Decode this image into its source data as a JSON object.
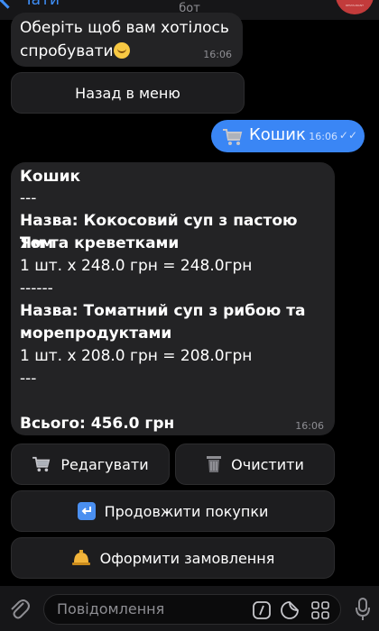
{
  "header": {
    "back_label": "Чати",
    "subtitle": "бот",
    "avatar_text": "RESTAURANT"
  },
  "messages": {
    "prompt": {
      "text": "Оберіть щоб вам хотілось\nспробувати",
      "emoji": "slightly-smiling-face",
      "time": "16:06"
    },
    "back_to_menu_button": "Назад в меню",
    "user_message": {
      "text": "Кошик",
      "icon": "shopping-cart-icon",
      "time": "16:06",
      "status": "read"
    },
    "cart": {
      "title": "Кошик",
      "separator1": "---",
      "item1_name": "Назва: Кокосовий суп з пастою Том",
      "item1_name_cont": "Ям та креветками",
      "item1_calc": "1 шт. x 248.0 грн = 248.0грн",
      "separator2": "------",
      "item2_name": "Назва: Томатний суп з рибою та",
      "item2_name_cont": "морепродуктами",
      "item2_calc": "1 шт. x 208.0 грн = 208.0грн",
      "separator3": "---",
      "total": "Всього: 456.0 грн",
      "time": "16:06"
    }
  },
  "keyboard": {
    "edit": "Редагувати",
    "clear": "Очистити",
    "continue": "Продовжити покупки",
    "checkout": "Оформити замовлення"
  },
  "composer": {
    "placeholder": "Повідомлення"
  },
  "colors": {
    "background": "#000000",
    "incoming_bubble": "#232325",
    "outgoing_bubble": "#3a86f5",
    "accent": "#3e8ef7"
  }
}
